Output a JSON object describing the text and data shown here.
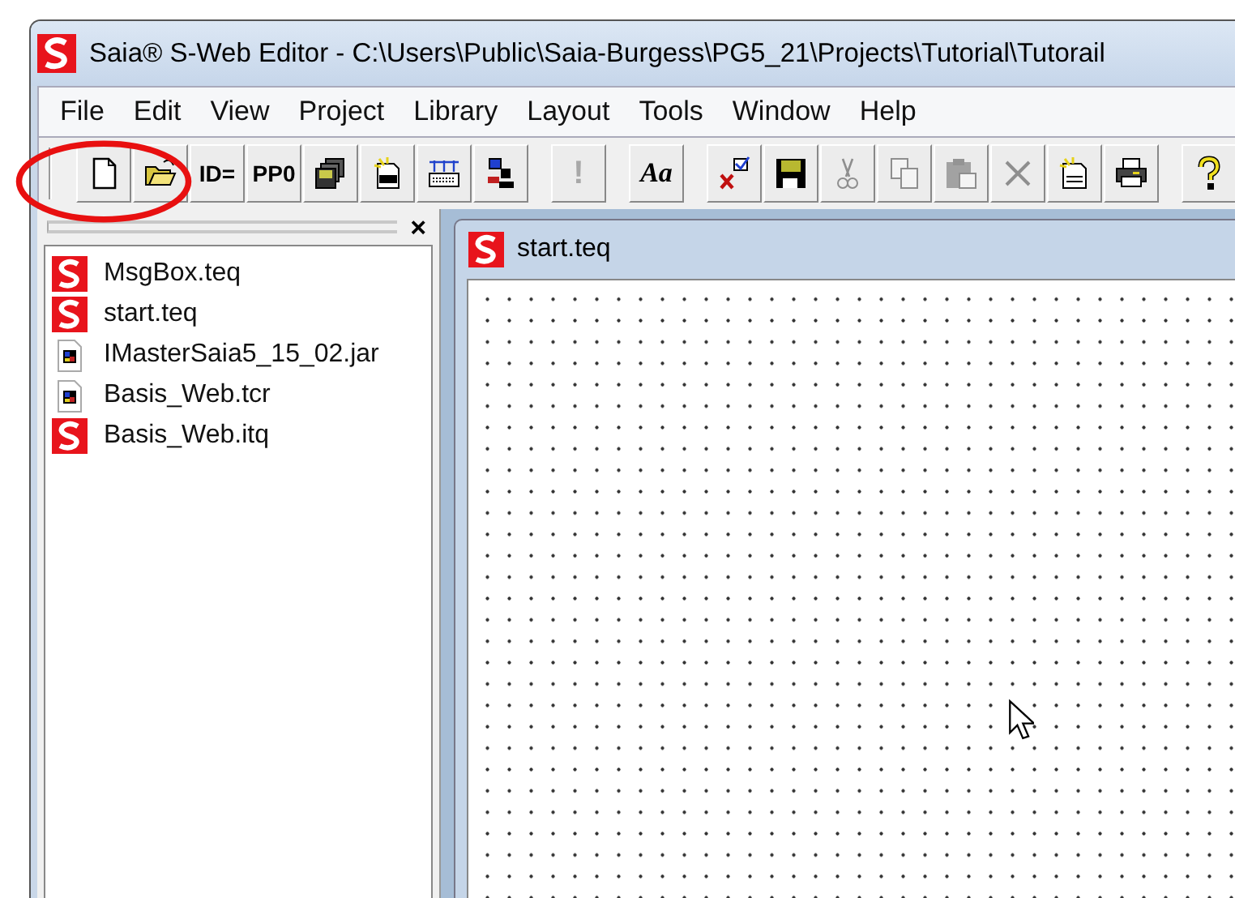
{
  "window": {
    "title": "Saia® S-Web Editor - C:\\Users\\Public\\Saia-Burgess\\PG5_21\\Projects\\Tutorial\\Tutorail"
  },
  "menu": [
    "File",
    "Edit",
    "View",
    "Project",
    "Library",
    "Layout",
    "Tools",
    "Window",
    "Help"
  ],
  "toolbar": [
    {
      "kind": "new",
      "disabled": false
    },
    {
      "kind": "open",
      "disabled": false
    },
    {
      "kind": "text",
      "label": "ID=",
      "disabled": false
    },
    {
      "kind": "text",
      "label": "PP0",
      "disabled": false
    },
    {
      "kind": "save-all",
      "disabled": false
    },
    {
      "kind": "html",
      "disabled": false
    },
    {
      "kind": "grid",
      "disabled": false
    },
    {
      "kind": "network",
      "disabled": false
    },
    {
      "kind": "separator"
    },
    {
      "kind": "text",
      "label": "!",
      "disabled": true
    },
    {
      "kind": "separator"
    },
    {
      "kind": "font",
      "label": "Aa",
      "disabled": false
    },
    {
      "kind": "separator"
    },
    {
      "kind": "check",
      "disabled": false
    },
    {
      "kind": "save",
      "disabled": false
    },
    {
      "kind": "cut",
      "disabled": true
    },
    {
      "kind": "copy",
      "disabled": true
    },
    {
      "kind": "paste",
      "disabled": true
    },
    {
      "kind": "delete",
      "disabled": true
    },
    {
      "kind": "csv",
      "disabled": false
    },
    {
      "kind": "print",
      "disabled": false
    },
    {
      "kind": "separator"
    },
    {
      "kind": "help",
      "disabled": false
    }
  ],
  "panel": {
    "close": "×",
    "files": [
      {
        "name": "MsgBox.teq",
        "kind": "saia"
      },
      {
        "name": "start.teq",
        "kind": "saia"
      },
      {
        "name": "IMasterSaia5_15_02.jar",
        "kind": "java"
      },
      {
        "name": "Basis_Web.tcr",
        "kind": "java"
      },
      {
        "name": "Basis_Web.itq",
        "kind": "saia"
      }
    ]
  },
  "document": {
    "title": "start.teq"
  }
}
